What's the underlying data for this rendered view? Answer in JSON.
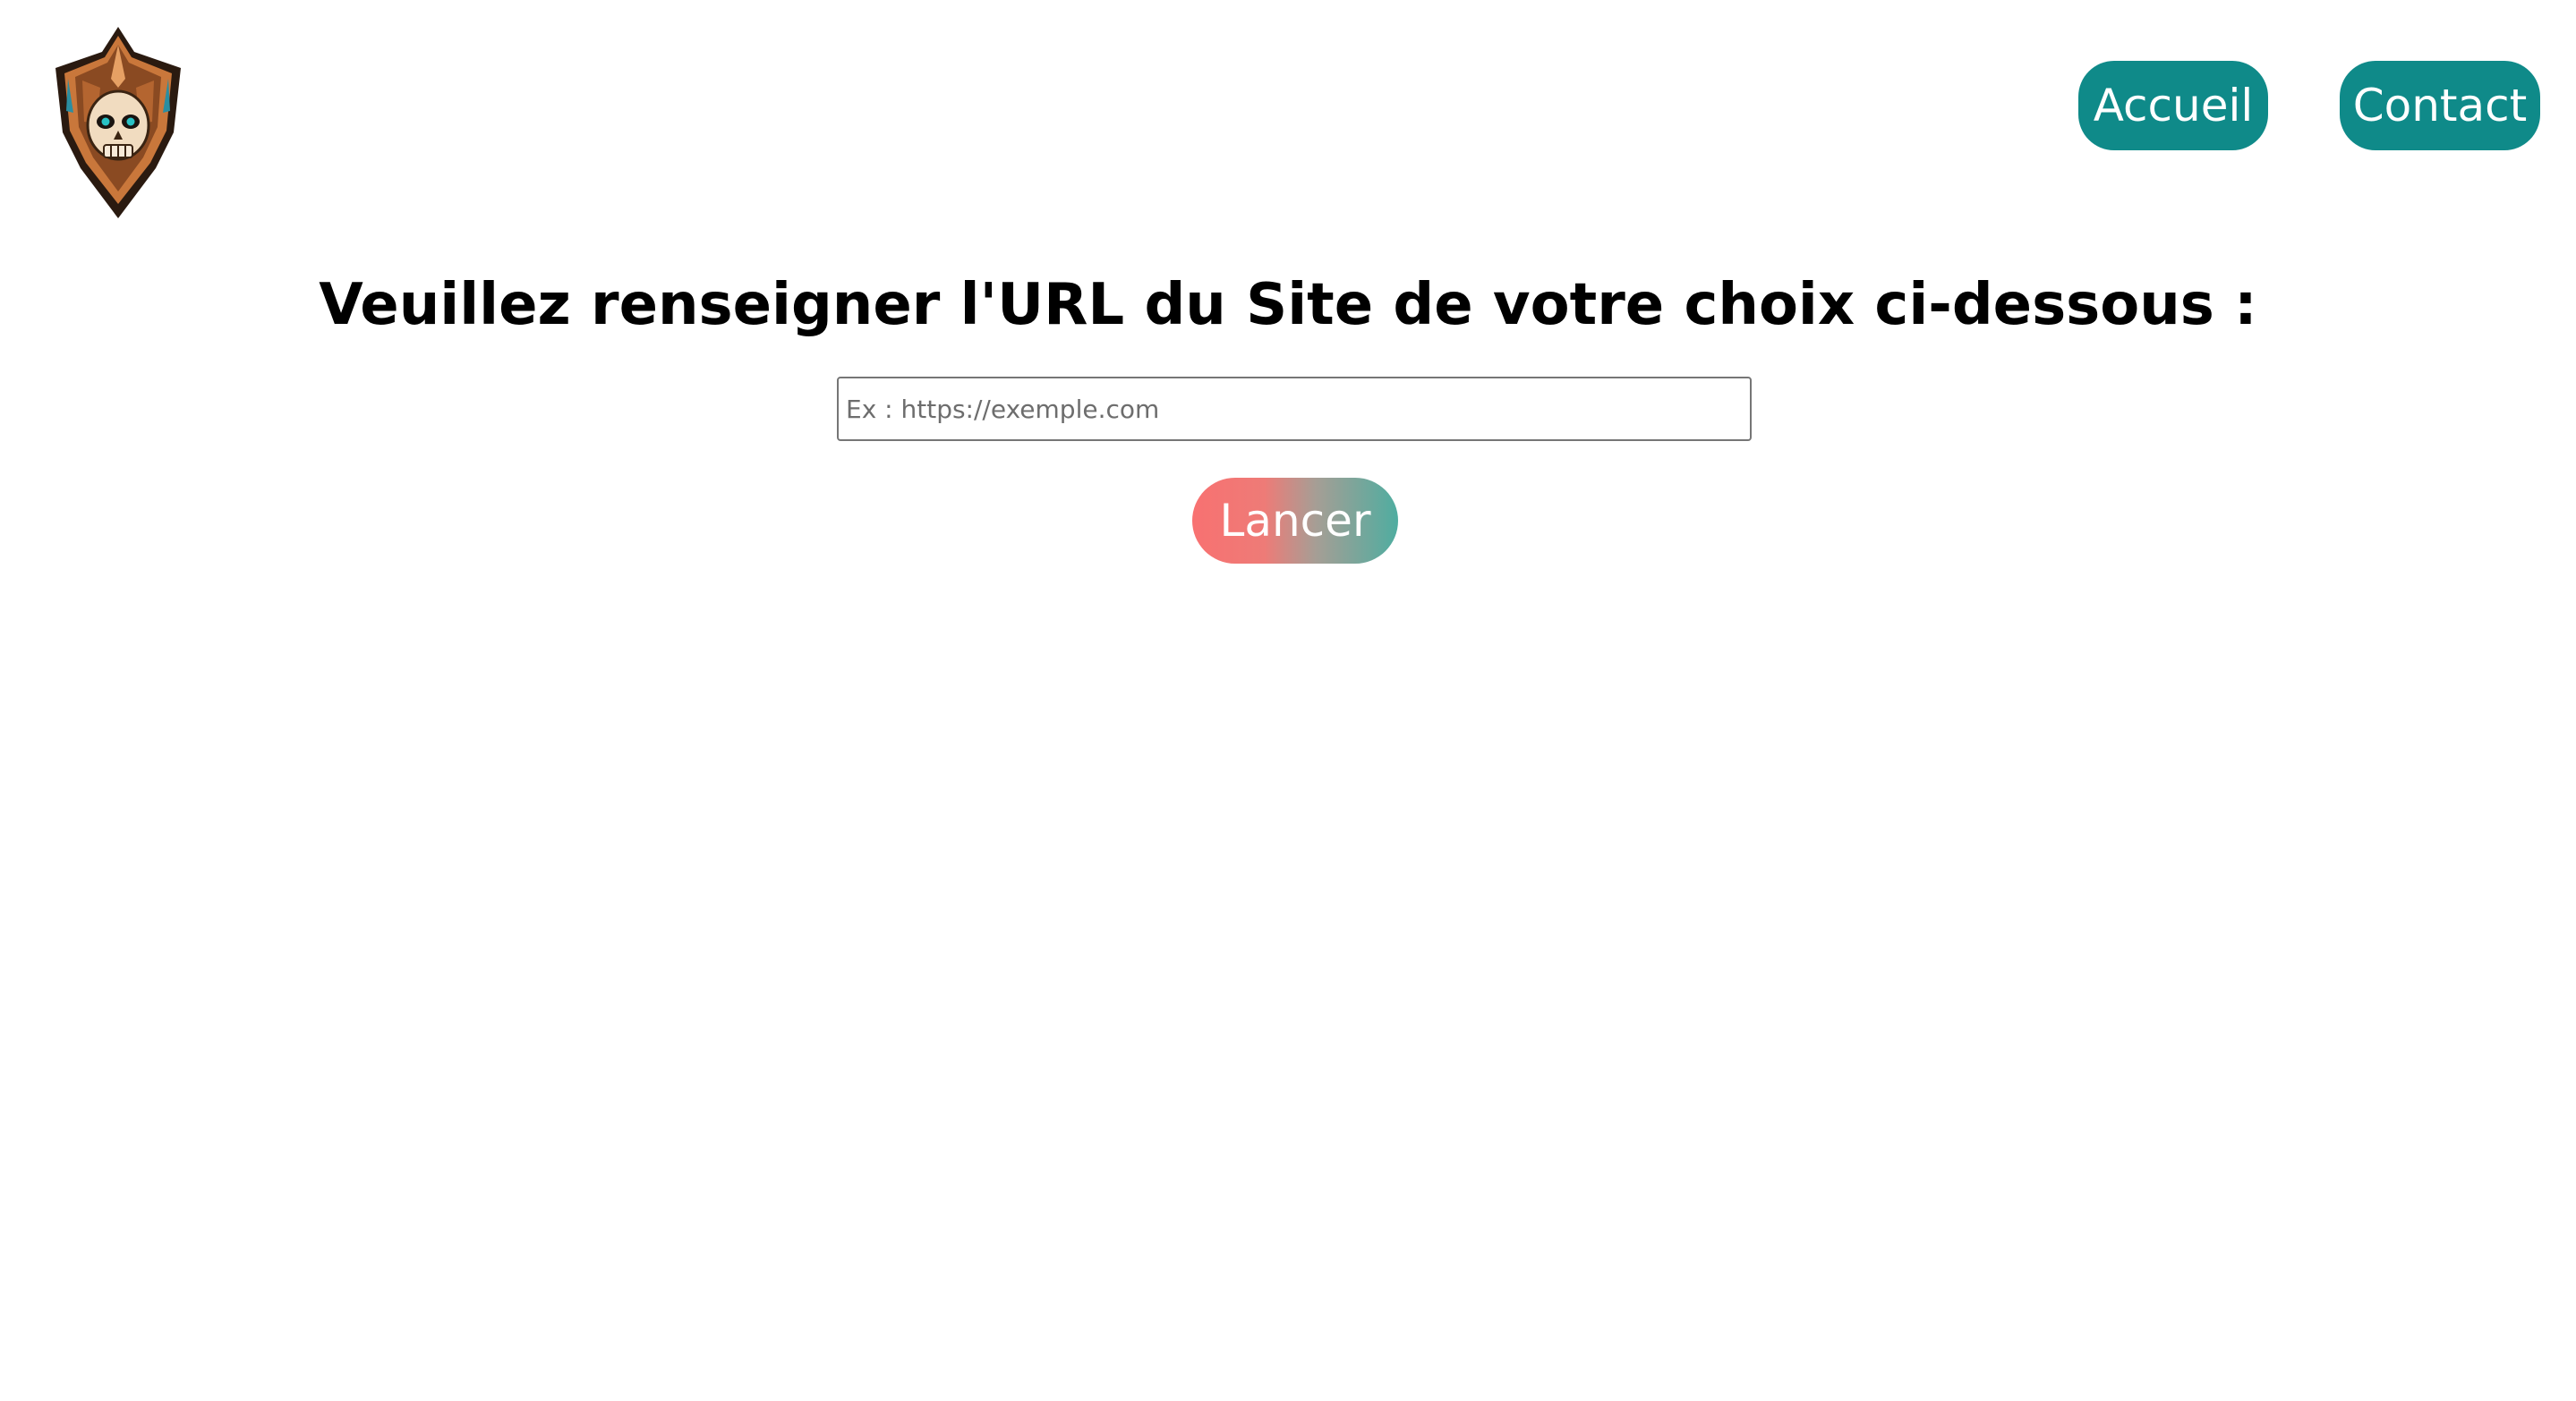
{
  "header": {
    "logo_icon": "skull-crest-logo-icon",
    "nav": [
      {
        "label": "Accueil"
      },
      {
        "label": "Contact"
      }
    ]
  },
  "main": {
    "title": "Veuillez renseigner l'URL du Site de votre choix ci-dessous :",
    "url_input": {
      "value": "",
      "placeholder": "Ex : https://exemple.com"
    },
    "launch_label": "Lancer"
  },
  "colors": {
    "nav_button": "#0f8a89",
    "launch_gradient_start": "#f87171",
    "launch_gradient_end": "#4fada0",
    "text": "#000000"
  }
}
